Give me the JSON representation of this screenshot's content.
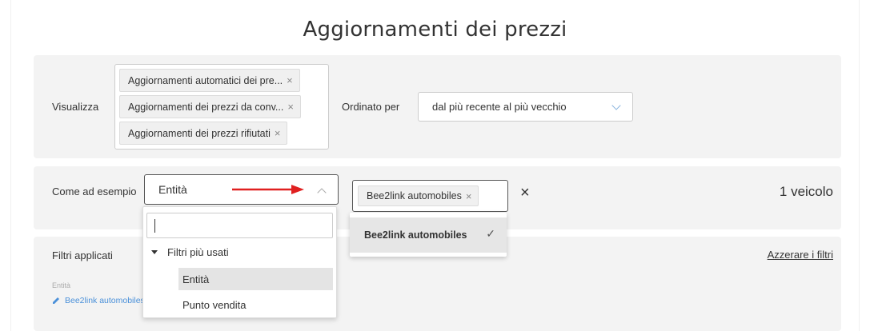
{
  "page": {
    "title": "Aggiornamenti dei prezzi"
  },
  "display": {
    "label": "Visualizza",
    "tags": [
      {
        "label": "Aggiornamenti automatici dei pre...",
        "remove": "×"
      },
      {
        "label": "Aggiornamenti dei prezzi da conv...",
        "remove": "×"
      },
      {
        "label": "Aggiornamenti dei prezzi rifiutati",
        "remove": "×"
      }
    ],
    "order_label": "Ordinato per",
    "order_value": "dal più recente al più vecchio"
  },
  "filter": {
    "label": "Come ad esempio",
    "entity_value": "Entità",
    "tags": [
      {
        "label": "Bee2link automobiles",
        "remove": "×"
      }
    ],
    "clear": "×",
    "count": "1 veicolo",
    "arrow_color": "#e02020"
  },
  "applied": {
    "label": "Filtri applicati",
    "reset": "Azzerare i filtri",
    "caption": "Entità",
    "value": "Bee2link automobiles"
  },
  "entity_dropdown": {
    "search_value": "",
    "group": "Filtri più usati",
    "options": [
      {
        "label": "Entità",
        "selected": true
      },
      {
        "label": "Punto vendita",
        "selected": false
      }
    ]
  },
  "value_dropdown": {
    "options": [
      {
        "label": "Bee2link automobiles",
        "check": "✓"
      }
    ]
  },
  "colors": {
    "panel": "#f3f3f3",
    "link": "#4a90d9",
    "chevron": "#8ab4de"
  }
}
